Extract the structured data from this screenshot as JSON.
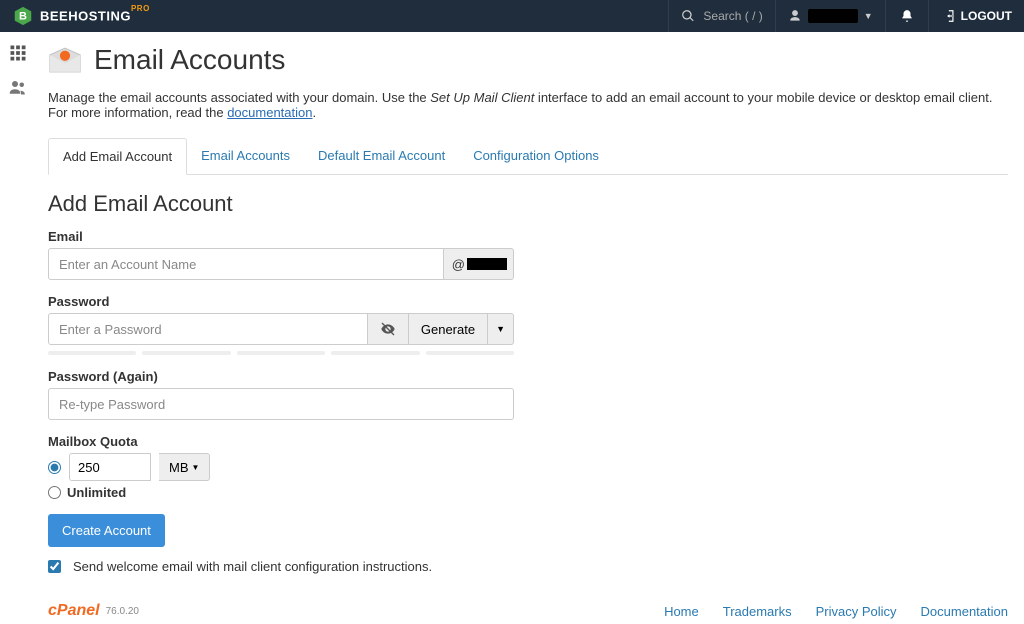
{
  "topbar": {
    "brand_main": "BEEHOSTING",
    "brand_suffix": "PRO",
    "search_icon": "search",
    "search_placeholder": "Search ( / )",
    "logout_label": "LOGOUT"
  },
  "page": {
    "title": "Email Accounts",
    "intro_before_em": "Manage the email accounts associated with your domain. Use the ",
    "intro_em": "Set Up Mail Client",
    "intro_after_em": " interface to add an email account to your mobile device or desktop email client. For more information, read the ",
    "intro_link": "documentation",
    "intro_end": "."
  },
  "tabs": [
    {
      "label": "Add Email Account",
      "active": true
    },
    {
      "label": "Email Accounts",
      "active": false
    },
    {
      "label": "Default Email Account",
      "active": false
    },
    {
      "label": "Configuration Options",
      "active": false
    }
  ],
  "form": {
    "section_title": "Add Email Account",
    "email_label": "Email",
    "email_placeholder": "Enter an Account Name",
    "domain_prefix": "@",
    "password_label": "Password",
    "password_placeholder": "Enter a Password",
    "generate_label": "Generate",
    "password_again_label": "Password (Again)",
    "password_again_placeholder": "Re-type Password",
    "mailbox_quota_label": "Mailbox Quota",
    "quota_value": "250",
    "quota_unit": "MB",
    "unlimited_label": "Unlimited",
    "create_btn": "Create Account",
    "welcome_label": "Send welcome email with mail client configuration instructions."
  },
  "footer": {
    "brand": "cPanel",
    "version": "76.0.20",
    "links": [
      "Home",
      "Trademarks",
      "Privacy Policy",
      "Documentation"
    ]
  }
}
